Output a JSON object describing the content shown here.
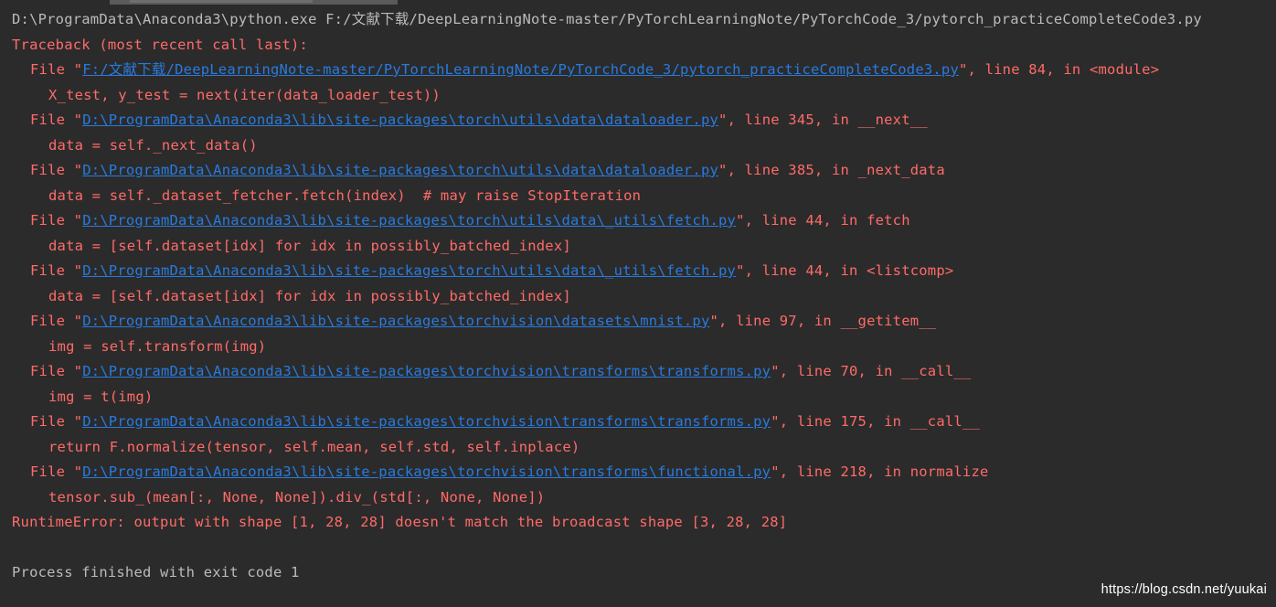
{
  "colors": {
    "background": "#2b2b2b",
    "command_text": "#bbbbbb",
    "error_text": "#ff6b68",
    "link_text": "#287bde",
    "watermark_text": "#ffffff"
  },
  "console": {
    "command": "D:\\ProgramData\\Anaconda3\\python.exe F:/文献下载/DeepLearningNote-master/PyTorchLearningNote/PyTorchCode_3/pytorch_practiceCompleteCode3.py",
    "traceback_header": "Traceback (most recent call last):",
    "frames": [
      {
        "prefix": "File \"",
        "path": "F:/文献下载/DeepLearningNote-master/PyTorchLearningNote/PyTorchCode_3/pytorch_practiceCompleteCode3.py",
        "suffix": "\", line 84, in <module>",
        "code": "X_test, y_test = next(iter(data_loader_test))"
      },
      {
        "prefix": "File \"",
        "path": "D:\\ProgramData\\Anaconda3\\lib\\site-packages\\torch\\utils\\data\\dataloader.py",
        "suffix": "\", line 345, in __next__",
        "code": "data = self._next_data()"
      },
      {
        "prefix": "File \"",
        "path": "D:\\ProgramData\\Anaconda3\\lib\\site-packages\\torch\\utils\\data\\dataloader.py",
        "suffix": "\", line 385, in _next_data",
        "code": "data = self._dataset_fetcher.fetch(index)  # may raise StopIteration"
      },
      {
        "prefix": "File \"",
        "path": "D:\\ProgramData\\Anaconda3\\lib\\site-packages\\torch\\utils\\data\\_utils\\fetch.py",
        "suffix": "\", line 44, in fetch",
        "code": "data = [self.dataset[idx] for idx in possibly_batched_index]"
      },
      {
        "prefix": "File \"",
        "path": "D:\\ProgramData\\Anaconda3\\lib\\site-packages\\torch\\utils\\data\\_utils\\fetch.py",
        "suffix": "\", line 44, in <listcomp>",
        "code": "data = [self.dataset[idx] for idx in possibly_batched_index]"
      },
      {
        "prefix": "File \"",
        "path": "D:\\ProgramData\\Anaconda3\\lib\\site-packages\\torchvision\\datasets\\mnist.py",
        "suffix": "\", line 97, in __getitem__",
        "code": "img = self.transform(img)"
      },
      {
        "prefix": "File \"",
        "path": "D:\\ProgramData\\Anaconda3\\lib\\site-packages\\torchvision\\transforms\\transforms.py",
        "suffix": "\", line 70, in __call__",
        "code": "img = t(img)"
      },
      {
        "prefix": "File \"",
        "path": "D:\\ProgramData\\Anaconda3\\lib\\site-packages\\torchvision\\transforms\\transforms.py",
        "suffix": "\", line 175, in __call__",
        "code": "return F.normalize(tensor, self.mean, self.std, self.inplace)"
      },
      {
        "prefix": "File \"",
        "path": "D:\\ProgramData\\Anaconda3\\lib\\site-packages\\torchvision\\transforms\\functional.py",
        "suffix": "\", line 218, in normalize",
        "code": "tensor.sub_(mean[:, None, None]).div_(std[:, None, None])"
      }
    ],
    "error_message": "RuntimeError: output with shape [1, 28, 28] doesn't match the broadcast shape [3, 28, 28]",
    "exit_message": "Process finished with exit code 1"
  },
  "watermark": "https://blog.csdn.net/yuukai"
}
